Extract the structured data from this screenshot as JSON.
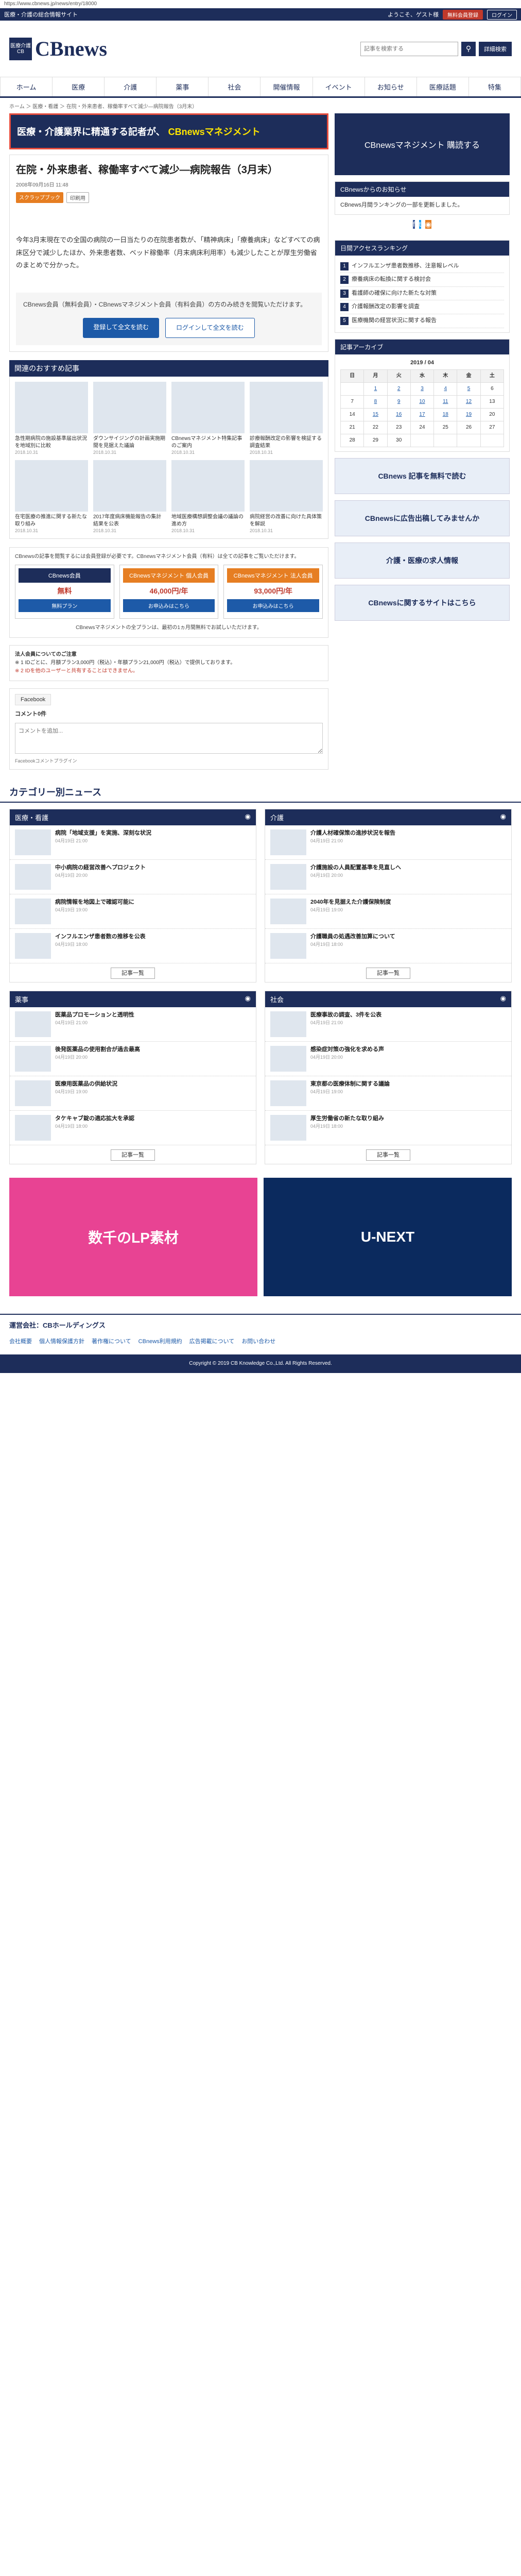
{
  "url": "https://www.cbnews.jp/news/entry/18000",
  "topbar": {
    "tagline": "医療・介護の総合情報サイト",
    "welcome": "ようこそ、ゲスト様",
    "register": "無料会員登録",
    "login": "ログイン"
  },
  "header": {
    "logo_box": "医療介護 CB",
    "logo_name": "CBnews",
    "search_placeholder": "記事を検索する",
    "search_icon": "search-icon",
    "detail_search": "詳細検索"
  },
  "nav": [
    "ホーム",
    "医療",
    "介護",
    "薬事",
    "社会",
    "開催情報",
    "イベント",
    "お知らせ",
    "医療話題",
    "特集"
  ],
  "breadcrumb": "ホーム ＞ 医療・看護 ＞ 在院・外来患者、稼働率すべて減少―病院報告（3月末）",
  "banner": {
    "text": "医療・介護業界に精通する記者が、",
    "highlight": "CBnewsマネジメント"
  },
  "article": {
    "title": "在院・外来患者、稼働率すべて減少―病院報告（3月末）",
    "date": "2008年09月16日 11:48",
    "tags": [
      "スクラップブック",
      "印刷用"
    ],
    "lead": "今年3月末現在での全国の病院の一日当たりの在院患者数が、「精神病床」「療養病床」などすべての病床区分で減少したほか、外来患者数、ベッド稼働率（月末病床利用率）も減少したことが厚生労働省のまとめで分かった。",
    "gate_text": "CBnews会員（無料会員）・CBnewsマネジメント会員（有料会員）の方のみ続きを閲覧いただけます。",
    "register_btn": "登録して全文を読む",
    "login_btn": "ログインして全文を読む"
  },
  "recommended": {
    "heading": "関連のおすすめ記事",
    "items": [
      {
        "title": "急性期病院の施設基準届出状況を地域別に比較",
        "date": "2018.10.31"
      },
      {
        "title": "ダウンサイジングの計画実施期間を見据えた議論",
        "date": "2018.10.31"
      },
      {
        "title": "CBnewsマネジメント特集記事のご案内",
        "date": "2018.10.31"
      },
      {
        "title": "診療報酬改定の影響を検証する調査結果",
        "date": "2018.10.31"
      },
      {
        "title": "在宅医療の推進に関する新たな取り組み",
        "date": "2018.10.31"
      },
      {
        "title": "2017年度病床機能報告の集計結果を公表",
        "date": "2018.10.31"
      },
      {
        "title": "地域医療構想調整会議の議論の進め方",
        "date": "2018.10.31"
      },
      {
        "title": "病院経営の改善に向けた具体策を解説",
        "date": "2018.10.31"
      }
    ]
  },
  "plans": {
    "intro": "CBnewsの記事を閲覧するには会員登録が必要です。CBnewsマネジメント会員（有料）は全ての記事をご覧いただけます。",
    "cols": [
      {
        "name": "CBnews会員",
        "price": "無料",
        "btn": "無料プラン"
      },
      {
        "name": "CBnewsマネジメント 個人会員",
        "price": "46,000円/年",
        "btn": "お申込みはこちら"
      },
      {
        "name": "CBnewsマネジメント 法人会員",
        "price": "93,000円/年",
        "btn": "お申込みはこちら"
      }
    ],
    "note": "CBnewsマネジメントの全プランは、最初の1ヵ月間無料でお試しいただけます。"
  },
  "notice": {
    "title": "法人会員についてのご注意",
    "body": "※ 1 IDごとに、月額プラン3,000円（税込）・年額プラン21,000円（税込）で提供しております。",
    "red": "※ 2 IDを他のユーザーと共有することはできません。"
  },
  "facebook": {
    "tab": "Facebook",
    "count": "コメント0件",
    "placeholder": "コメントを追加...",
    "plugin": "Facebookコメントプラグイン"
  },
  "sidebar": {
    "ad_top": "CBnewsマネジメント 購読する",
    "notice_heading": "CBnewsからのお知らせ",
    "notice_body": "CBnews月間ランキングの一部を更新しました。",
    "social_heading": "",
    "ranking_heading": "日間アクセスランキング",
    "ranking": [
      "インフルエンザ患者数推移、注意報レベル",
      "療養病床の転換に関する検討会",
      "看護師の確保に向けた新たな対策",
      "介護報酬改定の影響を調査",
      "医療機関の経営状況に関する報告"
    ],
    "calendar_heading": "記事アーカイブ",
    "calendar_month": "2019 / 04",
    "weekdays": [
      "日",
      "月",
      "火",
      "水",
      "木",
      "金",
      "土"
    ],
    "weeks": [
      [
        "",
        "1",
        "2",
        "3",
        "4",
        "5",
        "6"
      ],
      [
        "7",
        "8",
        "9",
        "10",
        "11",
        "12",
        "13"
      ],
      [
        "14",
        "15",
        "16",
        "17",
        "18",
        "19",
        "20"
      ],
      [
        "21",
        "22",
        "23",
        "24",
        "25",
        "26",
        "27"
      ],
      [
        "28",
        "29",
        "30",
        "",
        "",
        "",
        ""
      ]
    ],
    "ads": [
      "CBnews 記事を無料で読む",
      "CBnewsに広告出稿してみませんか",
      "介護・医療の求人情報",
      "CBnewsに関するサイトはこちら"
    ]
  },
  "categories": {
    "heading": "カテゴリー別ニュース",
    "blocks": [
      {
        "name": "医療・看護",
        "items": [
          {
            "title": "病院「地域支援」を実施、深刻な状況",
            "date": "04月19日 21:00"
          },
          {
            "title": "中小病院の経営改善へプロジェクト",
            "date": "04月19日 20:00"
          },
          {
            "title": "病院情報を地図上で確認可能に",
            "date": "04月19日 19:00"
          },
          {
            "title": "インフルエンザ患者数の推移を公表",
            "date": "04月19日 18:00"
          }
        ]
      },
      {
        "name": "介護",
        "items": [
          {
            "title": "介護人材確保策の進捗状況を報告",
            "date": "04月19日 21:00"
          },
          {
            "title": "介護施設の人員配置基準を見直しへ",
            "date": "04月19日 20:00"
          },
          {
            "title": "2040年を見据えた介護保険制度",
            "date": "04月19日 19:00"
          },
          {
            "title": "介護職員の処遇改善加算について",
            "date": "04月19日 18:00"
          }
        ]
      },
      {
        "name": "薬事",
        "items": [
          {
            "title": "医薬品プロモーションと透明性",
            "date": "04月19日 21:00"
          },
          {
            "title": "後発医薬品の使用割合が過去最高",
            "date": "04月19日 20:00"
          },
          {
            "title": "医療用医薬品の供給状況",
            "date": "04月19日 19:00"
          },
          {
            "title": "タケキャブ錠の適応拡大を承認",
            "date": "04月19日 18:00"
          }
        ]
      },
      {
        "name": "社会",
        "items": [
          {
            "title": "医療事故の調査、3件を公表",
            "date": "04月19日 21:00"
          },
          {
            "title": "感染症対策の強化を求める声",
            "date": "04月19日 20:00"
          },
          {
            "title": "東京都の医療体制に関する議論",
            "date": "04月19日 19:00"
          },
          {
            "title": "厚生労働省の新たな取り組み",
            "date": "04月19日 18:00"
          }
        ]
      }
    ],
    "more": "記事一覧"
  },
  "bottom_ads": [
    "数千のLP素材",
    "U-NEXT"
  ],
  "footer": {
    "company": "運営会社：CBホールディングス",
    "links": [
      "会社概要",
      "個人情報保護方針",
      "著作権について",
      "CBnews利用規約",
      "広告掲載について",
      "お問い合わせ"
    ],
    "copy": "Copyright © 2019 CB Knowledge Co.,Ltd. All Rights Reserved."
  }
}
